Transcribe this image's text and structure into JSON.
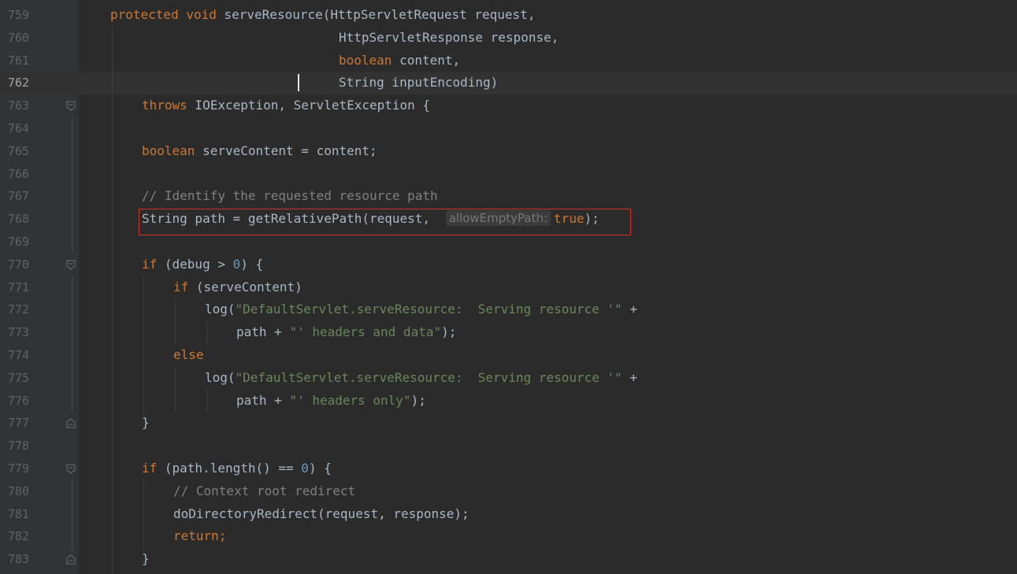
{
  "editor": {
    "lines": [
      {
        "no": "759"
      },
      {
        "no": "760"
      },
      {
        "no": "761"
      },
      {
        "no": "762"
      },
      {
        "no": "763"
      },
      {
        "no": "764"
      },
      {
        "no": "765"
      },
      {
        "no": "766"
      },
      {
        "no": "767"
      },
      {
        "no": "768"
      },
      {
        "no": "769"
      },
      {
        "no": "770"
      },
      {
        "no": "771"
      },
      {
        "no": "772"
      },
      {
        "no": "773"
      },
      {
        "no": "774"
      },
      {
        "no": "775"
      },
      {
        "no": "776"
      },
      {
        "no": "777"
      },
      {
        "no": "778"
      },
      {
        "no": "779"
      },
      {
        "no": "780"
      },
      {
        "no": "781"
      },
      {
        "no": "782"
      },
      {
        "no": "783"
      }
    ],
    "current_line": "762",
    "code": {
      "l759": [
        "protected",
        "void",
        " serveResource(HttpServletRequest request,"
      ],
      "l760": "HttpServletResponse response,",
      "l761": [
        "boolean",
        " content,"
      ],
      "l762": "String inputEncoding)",
      "l763": [
        "throws",
        " IOException, ServletException {"
      ],
      "l765": [
        "boolean",
        " serveContent = content;"
      ],
      "l767": "// Identify the requested resource path",
      "l768": {
        "pre": "String path = getRelativePath(request, ",
        "hint": "allowEmptyPath:",
        "val": "true",
        "post": ");"
      },
      "l770": [
        "if",
        " (debug > ",
        "0",
        ") {"
      ],
      "l771": [
        "if",
        " (serveContent)"
      ],
      "l772": [
        "log(",
        "\"DefaultServlet.serveResource:  Serving resource '\"",
        " +"
      ],
      "l773": [
        "path + ",
        "\"' headers and data\"",
        ");"
      ],
      "l774": "else",
      "l775": [
        "log(",
        "\"DefaultServlet.serveResource:  Serving resource '\"",
        " +"
      ],
      "l776": [
        "path + ",
        "\"' headers only\"",
        ");"
      ],
      "l777": "}",
      "l779": [
        "if",
        " (path.length() == ",
        "0",
        ") {"
      ],
      "l780": "// Context root redirect",
      "l781": "doDirectoryRedirect(request, response);",
      "l782": [
        "return",
        ";"
      ],
      "l783": "}"
    },
    "colors": {
      "background": "#2b2b2b",
      "keyword": "#cc7832",
      "string": "#6a8759",
      "number": "#6897bb",
      "comment": "#808080",
      "text": "#a9b7c6",
      "highlight_box": "#d0312d"
    }
  }
}
